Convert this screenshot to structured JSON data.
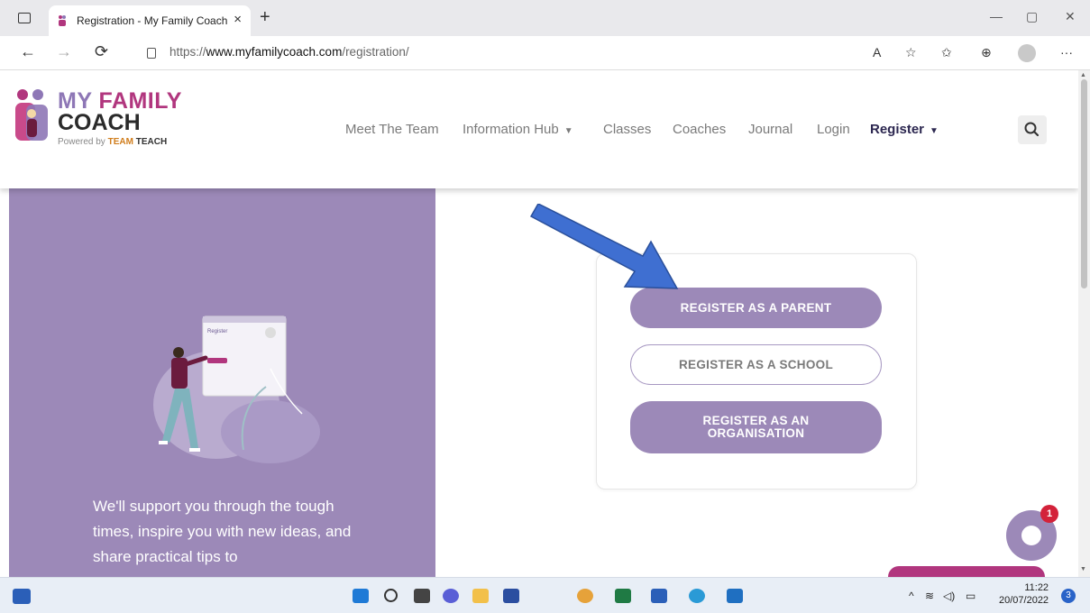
{
  "browser": {
    "tab_title": "Registration - My Family Coach",
    "tab_close": "×",
    "new_tab": "+",
    "url_prefix": "https://",
    "url_domain": "www.myfamilycoach.com",
    "url_path": "/registration/",
    "read_aloud": "A",
    "win_minimize": "—",
    "win_restore": "▢",
    "win_close": "✕",
    "more": "···"
  },
  "logo": {
    "line1_a": "MY",
    "line1_b": " FAMILY",
    "line2": "COACH",
    "powered_by": "Powered by",
    "brand_a": "TEAM",
    "brand_b": "TEACH"
  },
  "nav": {
    "meet_the_team": "Meet The Team",
    "information_hub": "Information Hub",
    "classes": "Classes",
    "coaches": "Coaches",
    "journal": "Journal",
    "login": "Login",
    "register": "Register",
    "caret": "▼"
  },
  "panel": {
    "text": "We'll support you through the tough times, inspire you with new ideas, and share practical tips to",
    "illustration_window_title": "Register"
  },
  "registration": {
    "parent": "REGISTER AS A PARENT",
    "school": "REGISTER AS A SCHOOL",
    "organisation_line1": "REGISTER AS AN",
    "organisation_line2": "ORGANISATION"
  },
  "chat": {
    "badge_count": "1"
  },
  "taskbar": {
    "time": "11:22",
    "date": "20/07/2022",
    "notification_count": "3",
    "tray_chevron": "^"
  },
  "colors": {
    "purple": "#9c89b8",
    "magenta": "#b1367e",
    "nav_active": "#2c2750",
    "arrow": "#3f6fd1"
  }
}
